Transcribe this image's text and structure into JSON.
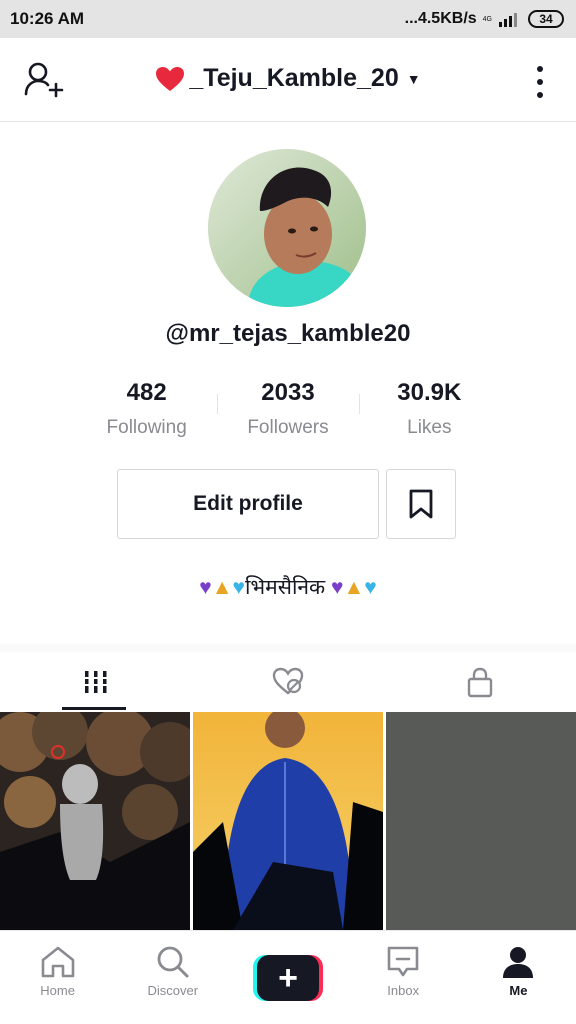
{
  "status_bar": {
    "time": "10:26 AM",
    "speed": "...4.5KB/s",
    "network": "4G",
    "battery": "34"
  },
  "header": {
    "title": "_Teju_Kamble_20",
    "title_prefix_icon": "red-heart-icon",
    "add_user_icon": "add-user-icon",
    "more_icon": "more-vertical-icon"
  },
  "profile": {
    "username": "@mr_tejas_kamble20",
    "stats": [
      {
        "value": "482",
        "label": "Following"
      },
      {
        "value": "2033",
        "label": "Followers"
      },
      {
        "value": "30.9K",
        "label": "Likes"
      }
    ],
    "edit_button": "Edit profile",
    "bio_text": "भिमसैनिक"
  },
  "tabs": [
    {
      "icon": "grid-icon",
      "active": true
    },
    {
      "icon": "liked-hidden-icon",
      "active": false
    },
    {
      "icon": "lock-icon",
      "active": false
    }
  ],
  "bottom_nav": [
    {
      "label": "Home",
      "icon": "home-icon"
    },
    {
      "label": "Discover",
      "icon": "search-icon"
    },
    {
      "label": "",
      "icon": "plus-icon"
    },
    {
      "label": "Inbox",
      "icon": "inbox-icon"
    },
    {
      "label": "Me",
      "icon": "person-icon"
    }
  ],
  "colors": {
    "accent_red": "#fe2c55",
    "accent_cyan": "#25f4ee",
    "text_primary": "#161823",
    "text_secondary": "#8a8b91"
  }
}
